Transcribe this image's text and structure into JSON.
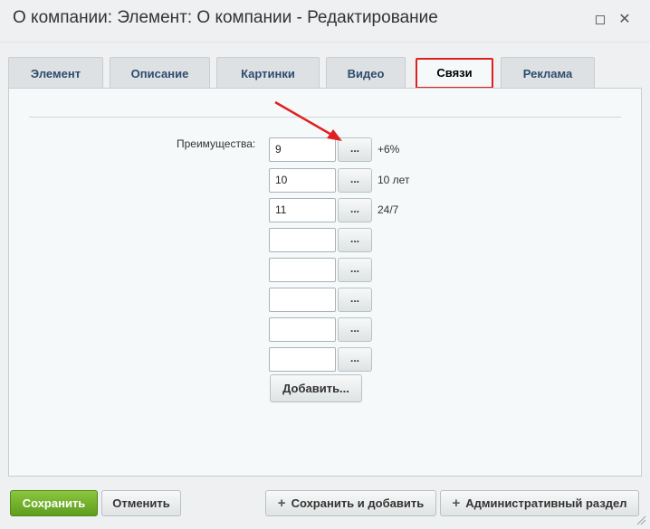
{
  "window": {
    "title": "О компании: Элемент: О компании - Редактирование",
    "maximize_icon": "maximize-icon",
    "close_icon": "close-icon",
    "close_glyph": "✕"
  },
  "tabs": [
    {
      "label": "Элемент",
      "active": false
    },
    {
      "label": "Описание",
      "active": false
    },
    {
      "label": "Картинки",
      "active": false
    },
    {
      "label": "Видео",
      "active": false
    },
    {
      "label": "Связи",
      "active": true
    },
    {
      "label": "Реклама",
      "active": false
    }
  ],
  "form": {
    "field_label": "Преимущества:",
    "browse_label": "...",
    "rows": [
      {
        "id": "9",
        "title": "+6%"
      },
      {
        "id": "10",
        "title": "10 лет"
      },
      {
        "id": "11",
        "title": "24/7"
      },
      {
        "id": "",
        "title": ""
      },
      {
        "id": "",
        "title": ""
      },
      {
        "id": "",
        "title": ""
      },
      {
        "id": "",
        "title": ""
      },
      {
        "id": "",
        "title": ""
      }
    ],
    "add_label": "Добавить..."
  },
  "annotation": {
    "arrow_color": "#e02020"
  },
  "footer": {
    "save_label": "Сохранить",
    "cancel_label": "Отменить",
    "save_add_label": "Сохранить и добавить",
    "admin_label": "Административный раздел",
    "plus_glyph": "+"
  },
  "colors": {
    "accent_green": "#6aaa28",
    "tab_text": "#2d4b6e",
    "highlight_red": "#e02020"
  }
}
